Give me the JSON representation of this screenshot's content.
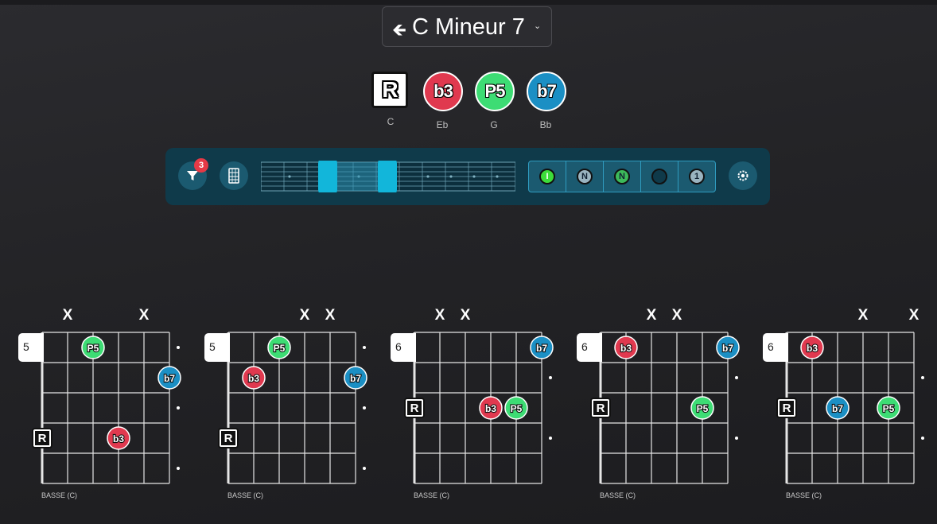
{
  "chord_selector": {
    "back_icon": "arrow-left-icon",
    "name": "C Mineur 7",
    "dropdown_icon": "chevron-down-icon"
  },
  "degrees": [
    {
      "label": "R",
      "note": "C",
      "color": "#ffffff"
    },
    {
      "label": "b3",
      "note": "Eb",
      "color": "#e0394f"
    },
    {
      "label": "P5",
      "note": "G",
      "color": "#3ddc74"
    },
    {
      "label": "b7",
      "note": "Bb",
      "color": "#1b8fc4"
    }
  ],
  "toolbar": {
    "filter_count": "3",
    "filter_icon": "filter-icon",
    "fretboard_icon": "fretboard-icon",
    "settings_icon": "gear-icon",
    "display_modes": [
      {
        "label": "I",
        "fill": "#3ddc3a"
      },
      {
        "label": "N",
        "fill": "#9ab4c0"
      },
      {
        "label": "N",
        "fill": "#3dba5a"
      },
      {
        "label": "",
        "fill": "#0f3a4a"
      },
      {
        "label": "1",
        "fill": "#9ab4c0"
      }
    ]
  },
  "colors": {
    "R": "#ffffff",
    "b3": "#e0394f",
    "P5": "#3ddc74",
    "b7": "#1b8fc4",
    "accent": "#0ab4d8"
  },
  "diagrams": [
    {
      "fret": "5",
      "bass": "BASSE (C)",
      "muted": [
        "X",
        "X"
      ]
    },
    {
      "fret": "5",
      "bass": "BASSE (C)",
      "muted": [
        "X",
        "X"
      ]
    },
    {
      "fret": "6",
      "bass": "BASSE (C)",
      "muted": [
        "X",
        "X"
      ]
    },
    {
      "fret": "6",
      "bass": "BASSE (C)",
      "muted": [
        "X",
        "X"
      ]
    },
    {
      "fret": "6",
      "bass": "BASSE (C)",
      "muted": [
        "X",
        "X"
      ]
    }
  ]
}
